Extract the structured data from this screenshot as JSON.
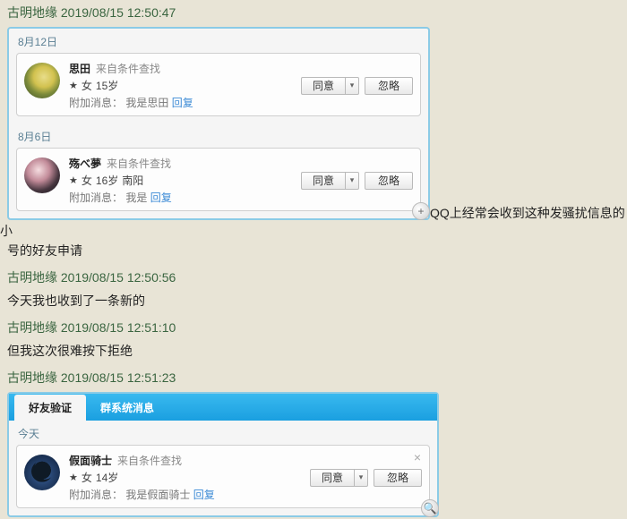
{
  "messages": [
    {
      "user": "古明地缘",
      "time": "2019/08/15 12:50:47"
    },
    {
      "user": "古明地缘",
      "time": "2019/08/15 12:50:56",
      "body": "今天我也收到了一条新的"
    },
    {
      "user": "古明地缘",
      "time": "2019/08/15 12:51:10",
      "body": "但我这次很难按下拒绝"
    },
    {
      "user": "古明地缘",
      "time": "2019/08/15 12:51:23"
    }
  ],
  "trailing_text_1a": "QQ上经常会收到这种发骚扰信息的小",
  "trailing_text_1b": "号的好友申请",
  "panel1": {
    "groups": [
      {
        "date": "8月12日",
        "name": "思田",
        "source": "来自条件查找",
        "gender": "女",
        "age": "15岁",
        "location": "",
        "msg_label": "附加消息：",
        "msg": "我是思田",
        "reply": "回复"
      },
      {
        "date": "8月6日",
        "name": "殇べ夢",
        "source": "来自条件查找",
        "gender": "女",
        "age": "16岁",
        "location": "南阳",
        "msg_label": "附加消息：",
        "msg": "我是",
        "reply": "回复"
      }
    ],
    "agree": "同意",
    "ignore": "忽略"
  },
  "panel2": {
    "tabs": {
      "friend": "好友验证",
      "group": "群系统消息"
    },
    "req": {
      "date": "今天",
      "name": "假面骑士",
      "source": "来自条件查找",
      "gender": "女",
      "age": "14岁",
      "msg_label": "附加消息：",
      "msg": "我是假面骑士",
      "reply": "回复"
    },
    "agree": "同意",
    "ignore": "忽略"
  }
}
